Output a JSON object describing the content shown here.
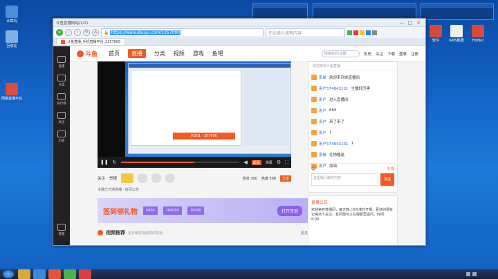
{
  "desktop": {
    "icons": [
      {
        "label": "计算机",
        "color": "#4a90d9"
      },
      {
        "label": "回收站",
        "color": "#7fb2e5"
      },
      {
        "label": "网络直播平台",
        "color": "#e04a3a"
      }
    ],
    "right_icons": [
      {
        "label": "软件",
        "color": "#d84a3a"
      },
      {
        "label": "AMS数据",
        "color": "#eeeeee"
      },
      {
        "label": "Fiddler",
        "color": "#d84a3a"
      }
    ]
  },
  "browser": {
    "title": "斗鱼直播网站(1/2)",
    "url": "https://www.douyu.com/1357000",
    "search_placeholder": "在此输入搜索内容",
    "tab_label": "斗鱼直播_手机直播平台_1357000",
    "caption": {
      "minimize": "—",
      "maximize": "□",
      "close": "×"
    }
  },
  "site": {
    "logo": "斗鱼",
    "logo_sub": "DOUYU.COM",
    "nav": [
      "首页",
      "直播",
      "分类",
      "视频",
      "游戏",
      "鱼吧"
    ],
    "nav_active_index": 1,
    "search_placeholder": "搜索房间/主播",
    "left_menu": [
      "直播",
      "分类",
      "排行榜",
      "关注",
      "历史",
      "客服"
    ],
    "header_right": [
      "历史",
      "关注",
      "下载",
      "登录",
      "注册"
    ]
  },
  "player": {
    "room_title": "HO01 · 357000",
    "progress_fraction": 0.62,
    "quality": "超清",
    "danmu_btn": "弹幕",
    "send_label": "发送"
  },
  "room_info": {
    "anchor_name": "主播",
    "follow": "关注",
    "report": "举报",
    "fans": "粉丝 300",
    "hot": "热度 308",
    "share": "分享",
    "notice": "主播已开通直播 · 房间公告"
  },
  "chat": {
    "header": "欢迎来到斗鱼直播",
    "messages": [
      {
        "name": "系统",
        "text": "欢迎来到本直播间"
      },
      {
        "name": "用户574843101",
        "text": "主播好厉害"
      },
      {
        "name": "用户",
        "text": "进入直播间"
      },
      {
        "name": "用户",
        "text": "666"
      },
      {
        "name": "用户",
        "text": "来了来了"
      },
      {
        "name": "用户",
        "text": "1"
      },
      {
        "name": "用户574843101",
        "text": "1"
      },
      {
        "name": "系统",
        "text": "礼物赠送"
      },
      {
        "name": "用户",
        "text": "加油"
      }
    ],
    "input_placeholder": "这里输入聊天内容",
    "send": "发送",
    "gift_label": "礼物"
  },
  "banner": {
    "text": "签到领礼物",
    "btn": "打开签到",
    "cards": [
      "5000",
      "100000",
      "10000"
    ]
  },
  "notice": {
    "title": "直播公告",
    "text": "欢迎来到直播间，每天晚上8点准时开播，喜欢的朋友记得点个关注，有问题可以在弹幕里提问。时间：8:00"
  },
  "video_rec": {
    "label": "视频推荐",
    "sub": "更多精彩视频等你发现",
    "more": "更多"
  },
  "taskbar": {
    "clock": ""
  },
  "colors": {
    "accent": "#f15a24",
    "desktop": "#1565c8",
    "player_bg": "#111111"
  }
}
